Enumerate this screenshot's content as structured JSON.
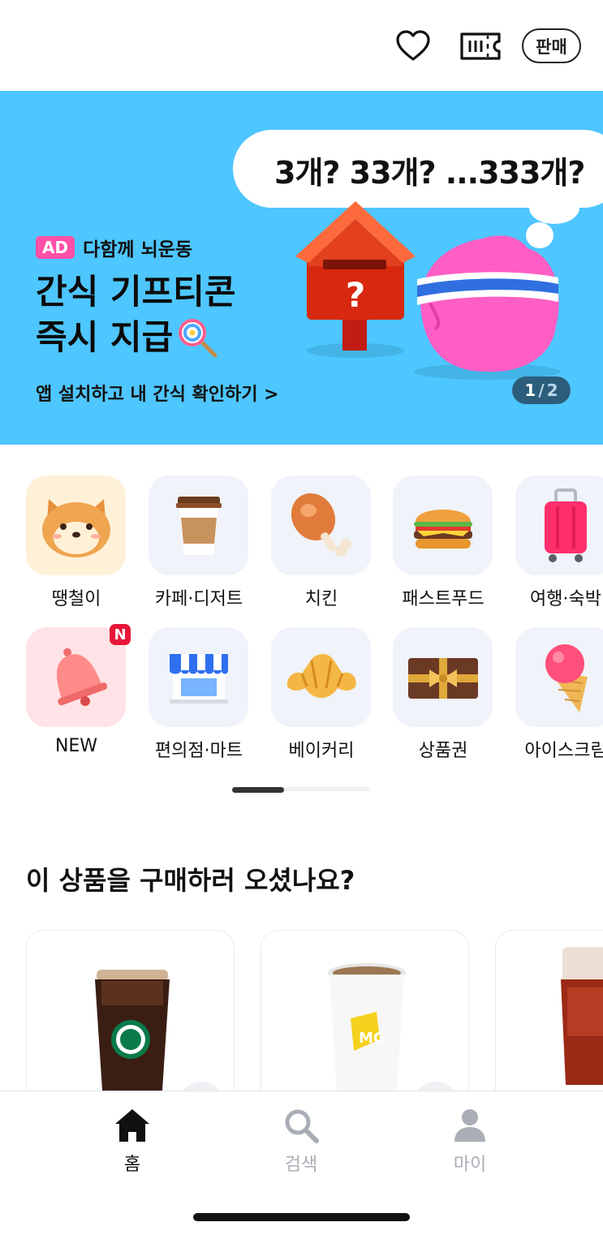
{
  "header": {
    "sell_label": "판매",
    "icons": [
      "heart-icon",
      "ticket-icon"
    ]
  },
  "banner": {
    "ad_badge": "AD",
    "sponsor": "다함께 뇌운동",
    "title_line1": "간식 기프티콘",
    "title_line2": "즉시 지급",
    "subtitle": "앱 설치하고 내 간식 확인하기 >",
    "bubble_text": "3개? 33개? ...333개?",
    "counter_current": "1",
    "counter_separator": "/",
    "counter_total": "2",
    "colors": {
      "background": "#4ec6ff",
      "ad_badge": "#ff4fa8"
    }
  },
  "categories": {
    "row1": [
      "땡철이",
      "카페·디저트",
      "치킨",
      "패스트푸드",
      "여행·숙박"
    ],
    "row2": [
      "NEW",
      "편의점·마트",
      "베이커리",
      "상품권",
      "아이스크림"
    ],
    "new_badge": "N"
  },
  "recommend": {
    "title": "이 상품을 구매하러 오셨나요?"
  },
  "bottom_nav": {
    "items": [
      {
        "label": "홈",
        "icon": "home-icon",
        "active": true
      },
      {
        "label": "검색",
        "icon": "search-icon",
        "active": false
      },
      {
        "label": "마이",
        "icon": "user-icon",
        "active": false
      }
    ]
  }
}
